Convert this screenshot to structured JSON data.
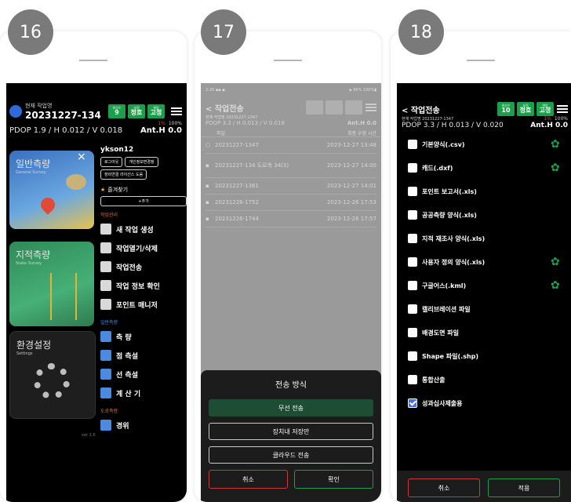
{
  "steps": [
    "16",
    "17",
    "18"
  ],
  "header": {
    "job_label": "현재 작업명",
    "job_name": "20231227-134",
    "chips": [
      {
        "top": "위성수",
        "value": "9"
      },
      {
        "top": "보정",
        "value": "정호"
      },
      {
        "top": "해법",
        "value": "고정"
      }
    ],
    "rtk_status": "1%",
    "battery": "100%",
    "pdop": "PDOP 1.9 / H 0.012 / V 0.018",
    "anth": "Ant.H 0.0"
  },
  "screen16": {
    "tiles": [
      {
        "title": "일반측량",
        "sub": "General Survey"
      },
      {
        "title": "지적측량",
        "sub": "Stake Survey"
      },
      {
        "title": "환경설정",
        "sub": "Settings"
      }
    ],
    "user": "ykson12",
    "pills": [
      "로그아웃",
      "개인정보변경정",
      "장비연결 라이선스 도움"
    ],
    "favorites": "즐겨찾기",
    "add_label": "+추가",
    "section_job": "작업관리",
    "job_items": [
      "새 작업 생성",
      "작업열기/삭제",
      "작업전송",
      "작업 정보 확인",
      "포인트 매니저"
    ],
    "section_survey": "일반측량",
    "survey_items": [
      "측 량",
      "점 측설",
      "선 측설",
      "계 산 기"
    ],
    "section_road": "도로측량",
    "road_items": [
      "경위"
    ],
    "close_glyph": "×",
    "version": "ver 1.6"
  },
  "screen17": {
    "status_left": "2:26 ▪▪ ◆",
    "status_right": "◈ 96% 100%▮",
    "title": "< 작업전송",
    "sub": "현재 작업명 20231227-1347",
    "pdop": "PDOP 3.3 / H 0.013 / V 0.018",
    "anth": "Ant.H 0.0",
    "col_headers": [
      "파일",
      "최종 수정 시간"
    ],
    "rows": [
      {
        "name": "20231227-1347",
        "date": "2023-12-27 13:48"
      },
      {
        "name": "20231227-134 도로측 34(3)",
        "date": "2023-12-27 14:00"
      },
      {
        "name": "20231227-1361",
        "date": "2023-12-27 14:01"
      },
      {
        "name": "20231226-1752",
        "date": "2023-12-26 17:53"
      },
      {
        "name": "20231226-1744",
        "date": "2023-12-26 17:57"
      }
    ],
    "sheet_title": "전송 방식",
    "options": [
      "무선 전송",
      "장치내 저장만",
      "클라우드 전송"
    ],
    "cancel": "취소",
    "confirm": "확인"
  },
  "screen18": {
    "title": "< 작업전송",
    "sub": "현재 작업명 20231227-1347",
    "chips": [
      {
        "top": "위성수",
        "value": "10"
      },
      {
        "top": "보정",
        "value": "정호"
      },
      {
        "top": "해법",
        "value": "고정"
      }
    ],
    "rtk_status": "1%",
    "battery": "100%",
    "pdop": "PDOP 3.3 / H 0.013 / V 0.020",
    "anth": "Ant.H 0.0",
    "options": [
      {
        "label": "기본양식(.csv)",
        "checked": false,
        "gear": true
      },
      {
        "label": "캐드(.dxf)",
        "checked": false,
        "gear": true
      },
      {
        "label": "포인트 보고서(.xls)",
        "checked": false,
        "gear": false
      },
      {
        "label": "공공측량 양식(.xls)",
        "checked": false,
        "gear": false
      },
      {
        "label": "지적 재조사 양식(.xls)",
        "checked": false,
        "gear": false
      },
      {
        "label": "사용자 정의 양식(.xls)",
        "checked": false,
        "gear": true
      },
      {
        "label": "구글어스(.kml)",
        "checked": false,
        "gear": true
      },
      {
        "label": "캘리브레이션 파일",
        "checked": false,
        "gear": false
      },
      {
        "label": "배경도면 파일",
        "checked": false,
        "gear": false
      },
      {
        "label": "Shape 파일(.shp)",
        "checked": false,
        "gear": false
      },
      {
        "label": "통합산출",
        "checked": false,
        "gear": false
      },
      {
        "label": "성과십사제출용",
        "checked": true,
        "gear": false
      }
    ],
    "cancel": "취소",
    "apply": "적용"
  },
  "colors": {
    "accent_green": "#1aa04a",
    "screen_bg": "#000000",
    "badge_gray": "#7a7a7a"
  }
}
